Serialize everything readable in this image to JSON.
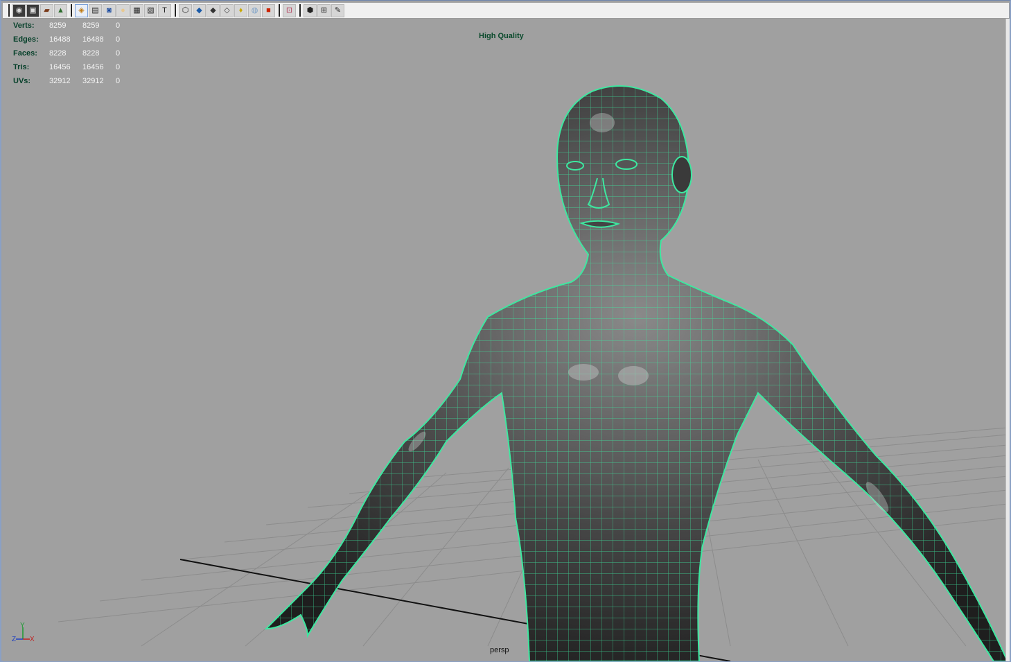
{
  "toolbar": {
    "icons": [
      "camera-icon",
      "camera-attrs-icon",
      "bookmark-icon",
      "image-plane-icon",
      "grid-icon",
      "film-gate-icon",
      "resolution-gate-icon",
      "safe-action-icon",
      "field-chart-icon",
      "safe-title-icon",
      "wireframe-icon",
      "smooth-shade-icon",
      "flat-shade-icon",
      "bounding-box-icon",
      "light-icon",
      "textured-icon",
      "shadows-icon",
      "isolate-select-icon",
      "xray-icon",
      "wireframe-on-shaded-icon",
      "xray-joints-icon"
    ]
  },
  "hud": {
    "rows": [
      {
        "label": "Verts:",
        "v1": "8259",
        "v2": "8259",
        "v3": "0"
      },
      {
        "label": "Edges:",
        "v1": "16488",
        "v2": "16488",
        "v3": "0"
      },
      {
        "label": "Faces:",
        "v1": "8228",
        "v2": "8228",
        "v3": "0"
      },
      {
        "label": "Tris:",
        "v1": "16456",
        "v2": "16456",
        "v3": "0"
      },
      {
        "label": "UVs:",
        "v1": "32912",
        "v2": "32912",
        "v3": "0"
      }
    ]
  },
  "viewport": {
    "quality_label": "High Quality",
    "camera_label": "persp"
  },
  "axis": {
    "y": "Y",
    "z": "Z",
    "x": "X"
  },
  "colors": {
    "wire": "#3de8a0",
    "background": "#a0a0a0",
    "mesh_dark": "#2e2e2e",
    "grid": "#8c8c8c"
  }
}
